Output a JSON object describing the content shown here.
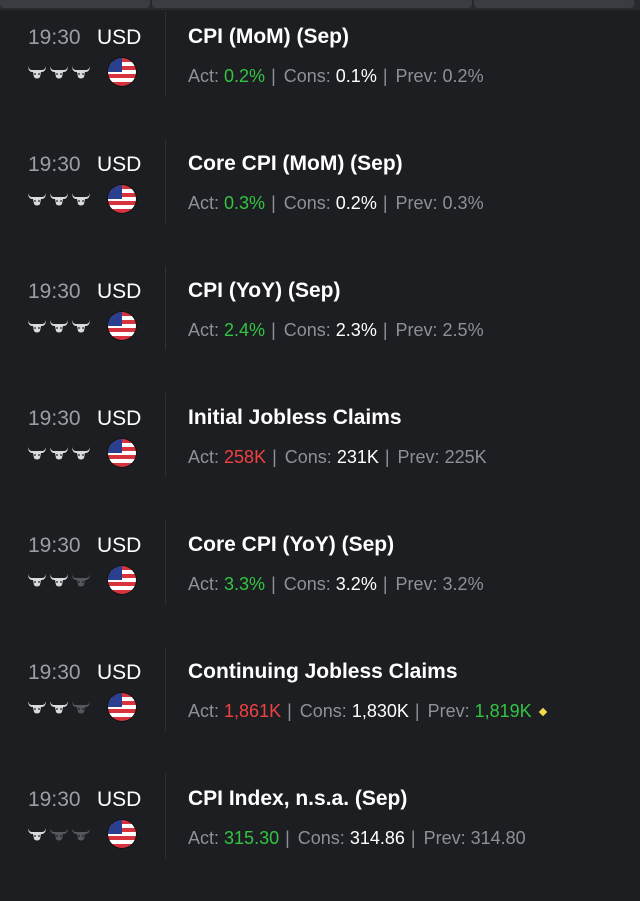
{
  "events": [
    {
      "time": "19:30",
      "currency": "USD",
      "title": "CPI (MoM) (Sep)",
      "importance": 3,
      "act_label": "Act:",
      "actual": "0.2%",
      "actual_color": "#33c442",
      "cons_label": "Cons:",
      "consensus": "0.1%",
      "prev_label": "Prev:",
      "previous": "0.2%",
      "previous_color": "#8e9096",
      "revised": false
    },
    {
      "time": "19:30",
      "currency": "USD",
      "title": "Core CPI (MoM) (Sep)",
      "importance": 3,
      "act_label": "Act:",
      "actual": "0.3%",
      "actual_color": "#33c442",
      "cons_label": "Cons:",
      "consensus": "0.2%",
      "prev_label": "Prev:",
      "previous": "0.3%",
      "previous_color": "#8e9096",
      "revised": false
    },
    {
      "time": "19:30",
      "currency": "USD",
      "title": "CPI (YoY) (Sep)",
      "importance": 3,
      "act_label": "Act:",
      "actual": "2.4%",
      "actual_color": "#33c442",
      "cons_label": "Cons:",
      "consensus": "2.3%",
      "prev_label": "Prev:",
      "previous": "2.5%",
      "previous_color": "#8e9096",
      "revised": false
    },
    {
      "time": "19:30",
      "currency": "USD",
      "title": "Initial Jobless Claims",
      "importance": 3,
      "act_label": "Act:",
      "actual": "258K",
      "actual_color": "#f04141",
      "cons_label": "Cons:",
      "consensus": "231K",
      "prev_label": "Prev:",
      "previous": "225K",
      "previous_color": "#8e9096",
      "revised": false
    },
    {
      "time": "19:30",
      "currency": "USD",
      "title": "Core CPI (YoY) (Sep)",
      "importance": 2,
      "act_label": "Act:",
      "actual": "3.3%",
      "actual_color": "#33c442",
      "cons_label": "Cons:",
      "consensus": "3.2%",
      "prev_label": "Prev:",
      "previous": "3.2%",
      "previous_color": "#8e9096",
      "revised": false
    },
    {
      "time": "19:30",
      "currency": "USD",
      "title": "Continuing Jobless Claims",
      "importance": 2,
      "act_label": "Act:",
      "actual": "1,861K",
      "actual_color": "#f04141",
      "cons_label": "Cons:",
      "consensus": "1,830K",
      "prev_label": "Prev:",
      "previous": "1,819K",
      "previous_color": "#33c442",
      "revised": true
    },
    {
      "time": "19:30",
      "currency": "USD",
      "title": "CPI Index, n.s.a. (Sep)",
      "importance": 1,
      "act_label": "Act:",
      "actual": "315.30",
      "actual_color": "#33c442",
      "cons_label": "Cons:",
      "consensus": "314.86",
      "prev_label": "Prev:",
      "previous": "314.80",
      "previous_color": "#8e9096",
      "revised": false
    }
  ],
  "colors": {
    "background": "#1c1e22",
    "divider": "#2e3035",
    "bull_active": "#d9dadc",
    "bull_inactive": "#55575c",
    "revised_marker": "#f2d94e"
  },
  "icons": {
    "importance": "bull-head-icon",
    "country": "us-flag-icon",
    "revised": "diamond-icon"
  }
}
